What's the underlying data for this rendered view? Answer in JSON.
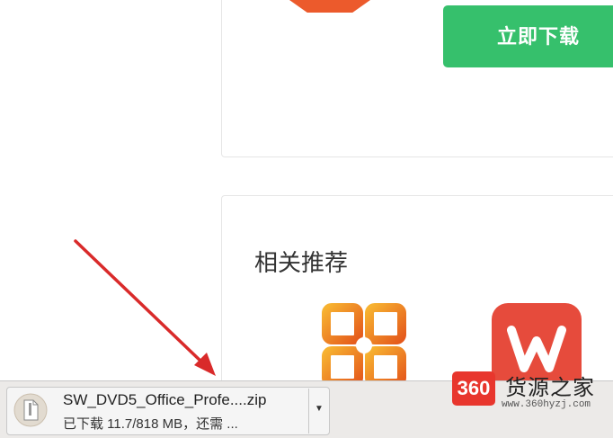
{
  "header": {
    "download_button_label": "立即下载"
  },
  "related": {
    "title": "相关推荐",
    "apps": [
      {
        "icon": "office-icon"
      },
      {
        "icon": "wps-icon"
      }
    ]
  },
  "download_shelf": {
    "file_name": "SW_DVD5_Office_Profe....zip",
    "status": "已下载 11.7/818 MB，还需 ...",
    "menu_glyph": "▼"
  },
  "watermark": {
    "badge": "360",
    "title": "货源之家",
    "url": "www.360hyzj.com"
  },
  "colors": {
    "download_button": "#36c06c",
    "arrow": "#d92a2a",
    "wps_icon": "#e64b3c",
    "watermark_badge": "#e8362d"
  }
}
